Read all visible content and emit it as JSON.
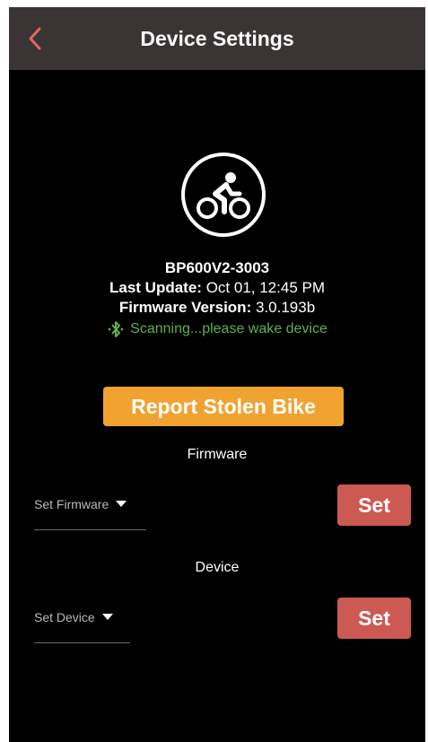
{
  "header": {
    "title": "Device Settings",
    "back_icon": "chevron-left-icon"
  },
  "device": {
    "name": "BP600V2-3003",
    "last_update_label": "Last Update:",
    "last_update_value": "Oct 01, 12:45 PM",
    "firmware_label": "Firmware Version:",
    "firmware_value": "3.0.193b",
    "status_text": "Scanning...please wake device",
    "status_icon": "bluetooth-icon",
    "device_icon": "cyclist-icon"
  },
  "report_button": {
    "label": "Report Stolen Bike"
  },
  "firmware_section": {
    "title": "Firmware",
    "select_placeholder": "Set Firmware",
    "set_label": "Set"
  },
  "device_section": {
    "title": "Device",
    "select_placeholder": "Set Device",
    "set_label": "Set"
  },
  "colors": {
    "header_bg": "#3a3534",
    "back_arrow": "#e0685b",
    "status_green": "#5fb04f",
    "report_orange": "#f0a331",
    "set_red": "#cc5a52"
  }
}
